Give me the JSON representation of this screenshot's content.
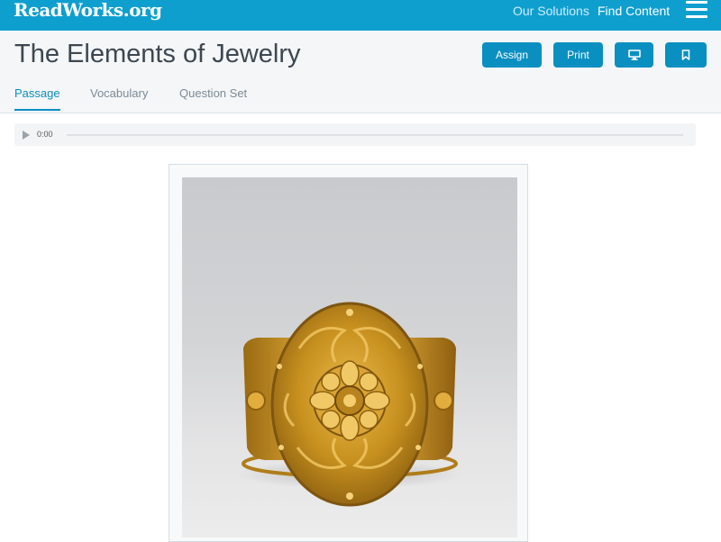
{
  "topbar": {
    "logo": "ReadWorks.org",
    "nav": {
      "our_solutions": "Our Solutions",
      "find_content": "Find Content"
    },
    "accent_color": "#0e9fcf"
  },
  "header": {
    "title": "The Elements of Jewelry",
    "buttons": {
      "assign": "Assign",
      "print": "Print"
    },
    "icons": {
      "present": "monitor-icon",
      "bookmark": "bookmark-icon"
    },
    "tabs": [
      {
        "label": "Passage",
        "active": true
      },
      {
        "label": "Vocabulary",
        "active": false
      },
      {
        "label": "Question Set",
        "active": false
      }
    ]
  },
  "audio": {
    "time": "0:00",
    "progress": 0
  },
  "passage": {
    "image": {
      "subject": "ornate gold bracelet"
    }
  }
}
